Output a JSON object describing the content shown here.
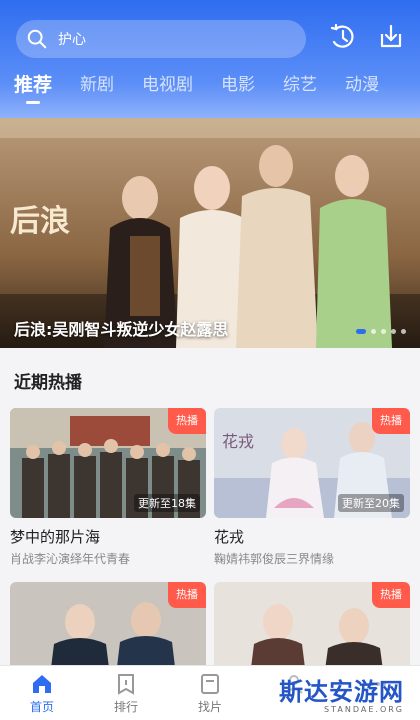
{
  "search": {
    "placeholder": "护心"
  },
  "tabs": [
    {
      "label": "推荐",
      "active": true
    },
    {
      "label": "新剧"
    },
    {
      "label": "电视剧"
    },
    {
      "label": "电影"
    },
    {
      "label": "综艺"
    },
    {
      "label": "动漫"
    }
  ],
  "banner": {
    "title": "后浪:吴刚智斗叛逆少女赵露思",
    "poster_text": "后浪"
  },
  "section": {
    "title": "近期热播"
  },
  "cards": [
    {
      "name": "梦中的那片海",
      "desc": "肖战李沁演绎年代青春",
      "badge": "热播",
      "episodes": "更新至18集"
    },
    {
      "name": "花戎",
      "desc": "鞠婧祎郭俊辰三界情缘",
      "badge": "热播",
      "episodes": "更新至20集",
      "poster_text": "花戎"
    },
    {
      "name": "",
      "desc": "",
      "badge": "热播",
      "episodes": ""
    },
    {
      "name": "",
      "desc": "",
      "badge": "热播",
      "episodes": ""
    }
  ],
  "bottom_nav": [
    {
      "label": "首页",
      "icon": "home-icon",
      "active": true
    },
    {
      "label": "排行",
      "icon": "ranking-icon"
    },
    {
      "label": "找片",
      "icon": "find-icon"
    },
    {
      "label": "",
      "icon": "user-icon"
    },
    {
      "label": "",
      "icon": "more-icon"
    }
  ],
  "watermark": {
    "cn": "斯达安游网",
    "en": "STANDAE.ORG"
  },
  "colors": {
    "accent": "#2f6df0",
    "badge": "#ff5a4a"
  }
}
